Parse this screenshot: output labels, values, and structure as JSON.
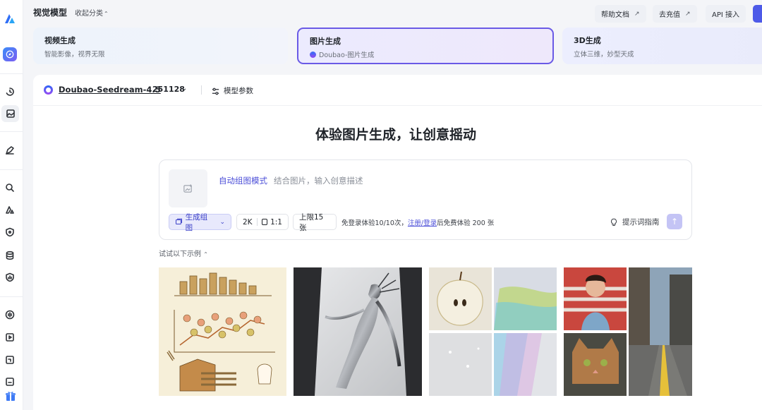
{
  "app": {
    "title": "视觉模型",
    "collapse_label": "收起分类"
  },
  "top_buttons": {
    "help": "帮助文档",
    "recharge": "去充值",
    "api": "API 接入"
  },
  "categories": [
    {
      "title": "视频生成",
      "subtitle": "智能影像，视界无限"
    },
    {
      "title": "图片生成",
      "subtitle": "Doubao-图片生成"
    },
    {
      "title": "3D生成",
      "subtitle": "立体三维，妙型天成"
    }
  ],
  "model": {
    "name": "Doubao-Seedream-4.5",
    "version": "251128",
    "params_label": "模型参数"
  },
  "headline": "体验图片生成，让创意摇动",
  "prompt": {
    "mode_label": "自动组图模式",
    "placeholder": "结合图片，输入创意描述",
    "generate_label": "生成组图",
    "resolution": "2K",
    "ratio": "1:1",
    "limit": "上限15张",
    "free_prefix": "免登录体验10/10次，",
    "free_link": "注册/登录",
    "free_suffix": "后免费体验 200 张",
    "tips_label": "提示词指南"
  },
  "examples_label": "试试以下示例",
  "colors": {
    "accent": "#4d5ae8",
    "selected_border": "#6a5ae6",
    "link": "#4c4fd8"
  }
}
